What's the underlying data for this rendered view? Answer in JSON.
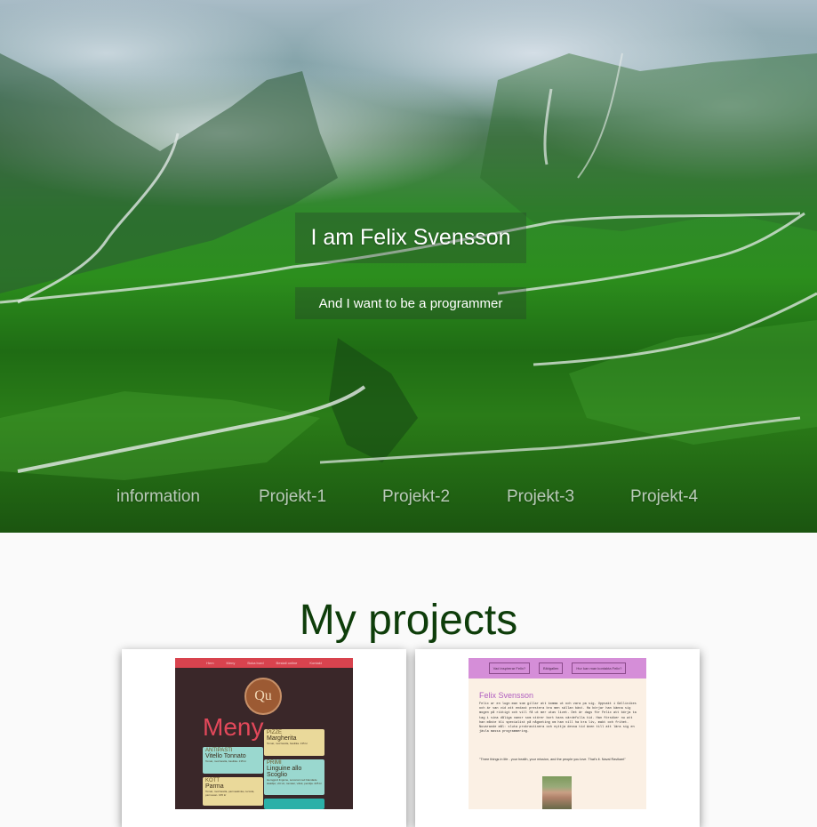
{
  "hero": {
    "title": "I am Felix Svensson",
    "subtitle": "And I want to be a programmer",
    "nav": [
      "information",
      "Projekt-1",
      "Projekt-2",
      "Projekt-3",
      "Projekt-4"
    ]
  },
  "projects": {
    "heading": "My projects",
    "restaurant_preview": {
      "topbar": [
        "Hem",
        "Meny",
        "Boka bord",
        "Bestall online",
        "Kontakt"
      ],
      "logo": "Qu",
      "title": "Meny",
      "items": [
        {
          "section": "PIZZE",
          "name": "Margherita",
          "desc": "Tomat, mozzarella, basilika. 135 kr"
        },
        {
          "section": "ANTIPASTI",
          "name": "Vitello Tonnato",
          "desc": "Tomat, mozzarella, basilika. 135 kr"
        },
        {
          "section": "PRIMI",
          "name": "Linguine allo Scoglio",
          "desc": "Hemgjord linguine, serverat med blandade skaldjur, vitt vin, tomater, vitlok, persilja. 225 kr"
        },
        {
          "section": "KOTT",
          "name": "Parma",
          "desc": "Tomat, mozzarella, parmaskinka, ruccola, parmesan. 165 kr"
        }
      ]
    },
    "personal_preview": {
      "topbar": [
        "Vad inspirerar Felix?",
        "Bildgallen",
        "Hur kan man kontakta Felix?"
      ],
      "name": "Felix Svensson",
      "paragraph": "Felix ar en lugn man som gillar att komma ut och vara pa sig. Uppvakt i Gällivikes och är van vid att endast prestera bra men sällan bäst. Ha börjar han känna sig mogen på riktigt och vill få ut mer utav livet. Det är dags för Felix att börja ta tag i sina dåliga vanor som störer bort hans värdefulla tid. Han försöker nu att han måste bli specialist på någonting om han vill ha bra liv, makt och frihet. Nuvarande mål: sluta prokrastinera och nyttja dessa tid även till att lära sig en jävla massa programmering.",
      "quote": "\"Three things in life - your health, your mission, and the people you love. That's it. Naval Ravikant\""
    }
  }
}
